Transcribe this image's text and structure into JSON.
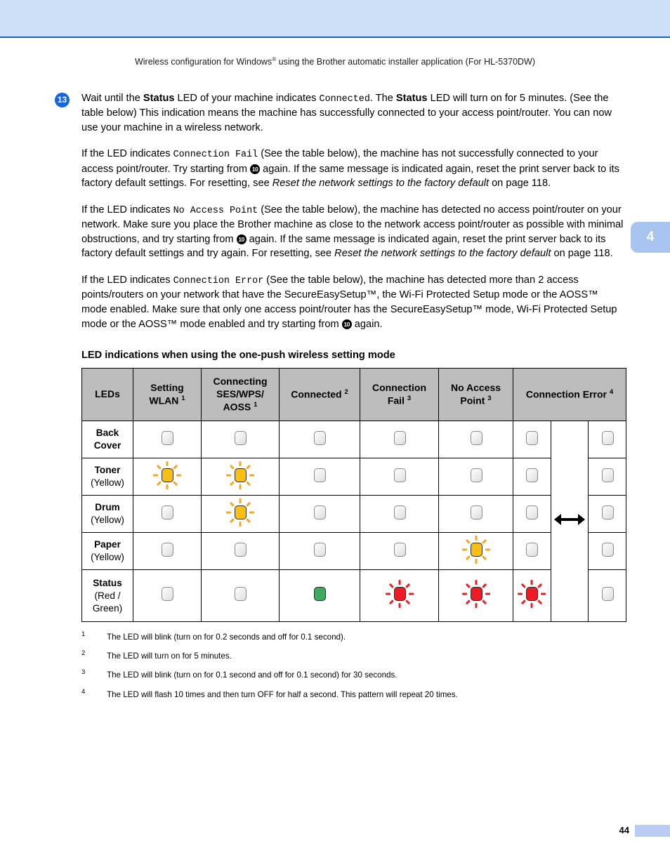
{
  "page": {
    "running_head_pre": "Wireless configuration for Windows",
    "running_head_sup": "®",
    "running_head_post": " using the Brother automatic installer application (For HL-5370DW)",
    "chapter_tab": "4",
    "page_number": "44",
    "header_color": "#cedff8",
    "header_rule_color": "#1b5bd0",
    "tab_color": "#a8c4f0",
    "accent_color": "#1565e0"
  },
  "step": {
    "number": "13",
    "text_1": "Wait until the ",
    "bold_1": "Status",
    "text_2": " LED of your machine indicates ",
    "mono_1": "Connected",
    "text_3": ". The ",
    "bold_2": "Status",
    "text_4": " LED will turn on for 5 minutes. (See the table below) This indication means the machine has successfully connected to your access point/router. You can now use your machine in a wireless network."
  },
  "paragraphs": [
    {
      "pre": "If the LED indicates ",
      "mono": "Connection Fail",
      "mid_1": " (See the table below), the machine has not successfully connected to your access point/router. Try starting from ",
      "badge": "10",
      "mid_2": " again. If the same message is indicated again, reset the print server back to its factory default settings. For resetting, see ",
      "italic": "Reset the network settings to the factory default",
      "post": " on page 118."
    },
    {
      "pre": "If the LED indicates ",
      "mono": "No Access Point",
      "mid_1": " (See the table below), the machine has detected no access point/router on your network. Make sure you place the Brother machine as close to the network access point/router as possible with minimal obstructions, and try starting from ",
      "badge": "10",
      "mid_2": " again. If the same message is indicated again, reset the print server back to its factory default settings and try again. For resetting, see ",
      "italic": "Reset the network settings to the factory default",
      "post": " on page 118."
    },
    {
      "pre": "If the LED indicates ",
      "mono": "Connection Error",
      "mid_1": " (See the table below), the machine has detected more than 2 access points/routers on your network that have the SecureEasySetup™, the Wi-Fi Protected Setup mode or the AOSS™ mode enabled. Make sure that only one access point/router has the SecureEasySetup™ mode, Wi-Fi Protected Setup mode or the AOSS™ mode enabled and try starting from ",
      "badge": "10",
      "mid_2": " again.",
      "italic": "",
      "post": ""
    }
  ],
  "table": {
    "title": "LED indications when using the one-push wireless setting mode",
    "header_bg": "#bdbdbd",
    "columns": [
      {
        "label": "LEDs",
        "sup": ""
      },
      {
        "label": "Setting\nWLAN",
        "sup": "1"
      },
      {
        "label": "Connecting\nSES/WPS/\nAOSS",
        "sup": "1"
      },
      {
        "label": "Connected",
        "sup": "2"
      },
      {
        "label": "Connection\nFail",
        "sup": "3"
      },
      {
        "label": "No Access\nPoint",
        "sup": "3"
      },
      {
        "label": "Connection Error",
        "sup": "4"
      }
    ],
    "col_headers": {
      "leds": "LEDs",
      "setting_wlan_l1": "Setting",
      "setting_wlan_l2": "WLAN",
      "setting_wlan_sup": "1",
      "connecting_l1": "Connecting",
      "connecting_l2": "SES/WPS/",
      "connecting_l3": "AOSS",
      "connecting_sup": "1",
      "connected": "Connected",
      "connected_sup": "2",
      "conn_fail_l1": "Connection",
      "conn_fail_l2": "Fail",
      "conn_fail_sup": "3",
      "no_ap_l1": "No Access",
      "no_ap_l2": "Point",
      "no_ap_sup": "3",
      "conn_error": "Connection Error",
      "conn_error_sup": "4"
    },
    "rows": [
      {
        "name": "Back",
        "name2": "Cover",
        "color": "",
        "states": [
          "off",
          "off",
          "off",
          "off",
          "off"
        ],
        "error_left": "off",
        "error_right": "off"
      },
      {
        "name": "Toner",
        "name2": "",
        "color": "(Yellow)",
        "states": [
          "yellow-blink",
          "yellow-blink",
          "off",
          "off",
          "off"
        ],
        "error_left": "off",
        "error_right": "off"
      },
      {
        "name": "Drum",
        "name2": "",
        "color": "(Yellow)",
        "states": [
          "off",
          "yellow-blink",
          "off",
          "off",
          "off"
        ],
        "error_left": "off",
        "error_right": "off"
      },
      {
        "name": "Paper",
        "name2": "",
        "color": "(Yellow)",
        "states": [
          "off",
          "off",
          "off",
          "off",
          "yellow-blink"
        ],
        "error_left": "off",
        "error_right": "off"
      },
      {
        "name": "Status",
        "name2": "",
        "color": "(Red /\nGreen)",
        "color_l1": "(Red /",
        "color_l2": "Green)",
        "states": [
          "off",
          "off",
          "green-on",
          "red-blink",
          "red-blink"
        ],
        "error_left": "red-blink",
        "error_right": "off"
      }
    ],
    "arrow_icon": "double-arrow"
  },
  "footnotes": [
    {
      "num": "1",
      "text": "The LED will blink (turn on for 0.2 seconds and off for 0.1 second)."
    },
    {
      "num": "2",
      "text": "The LED will turn on for 5 minutes."
    },
    {
      "num": "3",
      "text": "The LED will blink (turn on for 0.1 second and off for 0.1 second) for 30 seconds."
    },
    {
      "num": "4",
      "text": "The LED will flash 10 times and then turn OFF for half a second. This pattern will repeat 20 times."
    }
  ]
}
